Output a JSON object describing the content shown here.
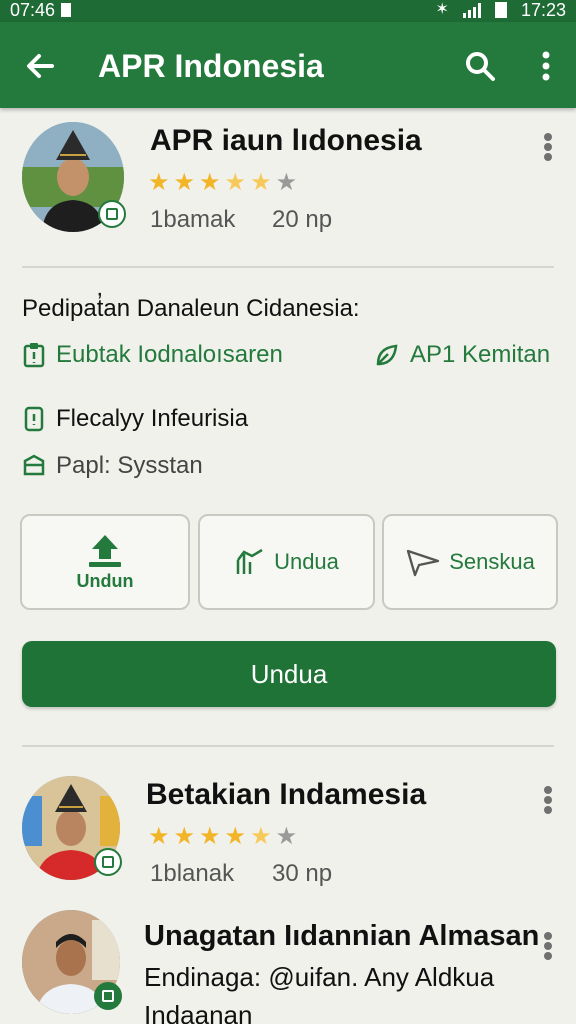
{
  "status_bar": {
    "time_left": "07:46",
    "time_right": "17:23"
  },
  "app_bar": {
    "title": "APR Indonesia",
    "back_icon": "arrow-left-icon",
    "search_icon": "search-icon",
    "more_icon": "more-vert-icon"
  },
  "featured": {
    "title": "APR iaun lıdonesia",
    "rating": 3.5,
    "meta_left": "1bamak",
    "meta_right": "20 np"
  },
  "details": {
    "heading": "Pedipat̓an Danaleun Cidanesia:",
    "link_left": "Eubtak Iodnaloısaren",
    "link_right": "AP1 Kemitan",
    "row_one": "Flecalyy Infeurisia",
    "row_two": "Papl: Sysstan"
  },
  "actions": {
    "upload_label": "Undun",
    "chart_label": "Undua",
    "share_label": "Senskua",
    "primary_label": "Undua"
  },
  "list": [
    {
      "title": "Betakian Indamesia",
      "rating": 3.5,
      "meta_left": "1blanak",
      "meta_right": "30 np"
    },
    {
      "title": "Unagatan Iıdannian Almasan",
      "line1": "Endinaga: @uifan. Any Aldkua",
      "line2": "Indaanan"
    }
  ],
  "colors": {
    "app_bar": "#237a3c",
    "accent": "#237a3c",
    "primary_button": "#1f7336",
    "star": "#f1b527"
  }
}
